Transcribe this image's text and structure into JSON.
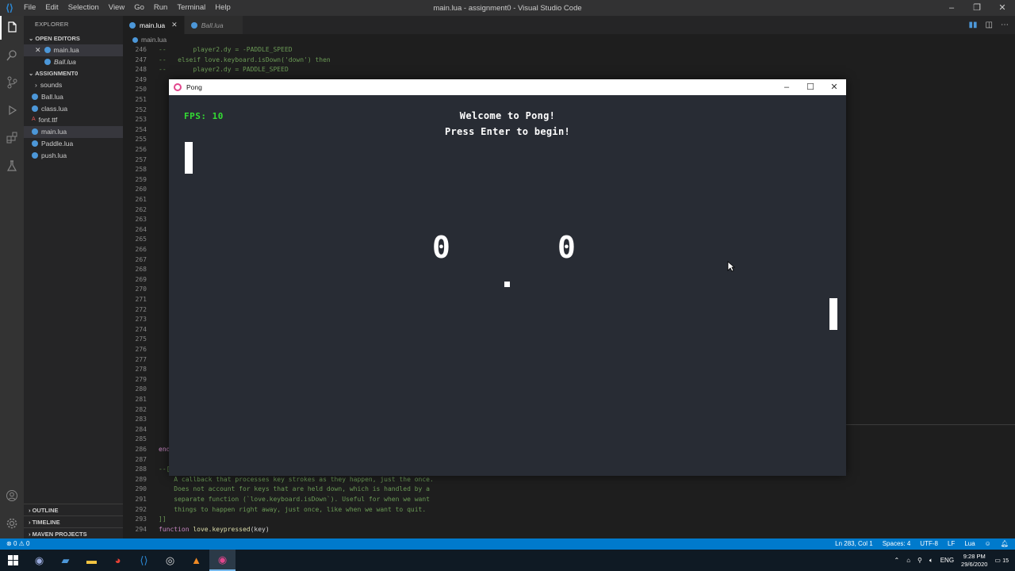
{
  "titlebar": {
    "menu": [
      "File",
      "Edit",
      "Selection",
      "View",
      "Go",
      "Run",
      "Terminal",
      "Help"
    ],
    "title": "main.lua - assignment0 - Visual Studio Code"
  },
  "sidebar": {
    "title": "EXPLORER",
    "open_editors_header": "OPEN EDITORS",
    "open_editors": [
      {
        "label": "main.lua"
      },
      {
        "label": "Ball.lua"
      }
    ],
    "project_header": "ASSIGNMENT0",
    "files": [
      {
        "label": "sounds",
        "kind": "folder"
      },
      {
        "label": "Ball.lua",
        "kind": "lua"
      },
      {
        "label": "class.lua",
        "kind": "lua"
      },
      {
        "label": "font.ttf",
        "kind": "font"
      },
      {
        "label": "main.lua",
        "kind": "lua"
      },
      {
        "label": "Paddle.lua",
        "kind": "lua"
      },
      {
        "label": "push.lua",
        "kind": "lua"
      }
    ],
    "outline": "OUTLINE",
    "timeline": "TIMELINE",
    "maven": "MAVEN PROJECTS"
  },
  "tabs": [
    {
      "label": "main.lua"
    },
    {
      "label": "Ball.lua"
    }
  ],
  "breadcrumb": "main.lua",
  "editor": {
    "line_numbers": [
      "246",
      "247",
      "248",
      "249",
      "250",
      "251",
      "252",
      "253",
      "254",
      "255",
      "256",
      "257",
      "258",
      "259",
      "260",
      "261",
      "262",
      "263",
      "264",
      "265",
      "266",
      "267",
      "268",
      "269",
      "270",
      "271",
      "272",
      "273",
      "274",
      "275",
      "276",
      "277",
      "278",
      "279",
      "280",
      "281",
      "282",
      "283",
      "284",
      "285",
      "286",
      "287",
      "288",
      "289",
      "290",
      "291",
      "292",
      "293",
      "294"
    ],
    "code_top": [
      "--       player2.dy = -PADDLE_SPEED",
      "--   elseif love.keyboard.isDown('down') then",
      "--       player2.dy = PADDLE_SPEED"
    ],
    "code_end": "end",
    "code_comment_open": "--[[",
    "comment_lines": [
      "    A callback that processes key strokes as they happen, just the once.",
      "    Does not account for keys that are held down, which is handled by a",
      "    separate function (`love.keyboard.isDown`). Useful for when we want",
      "    things to happen right away, just once, like when we want to quit."
    ],
    "comment_close": "]]",
    "fn_keyword": "function",
    "fn_name": "love.keypressed",
    "fn_args": "(key)"
  },
  "pong": {
    "window_title": "Pong",
    "fps_label": "FPS: 10",
    "welcome": "Welcome to Pong!",
    "press_enter": "Press Enter to begin!",
    "player1_score": "0",
    "player2_score": "0"
  },
  "statusbar": {
    "errors": "0",
    "warnings": "0",
    "position": "Ln 283, Col 1",
    "spaces": "Spaces: 4",
    "encoding": "UTF-8",
    "eol": "LF",
    "language": "Lua"
  },
  "taskbar": {
    "language": "ENG",
    "time": "9:28 PM",
    "date": "29/6/2020",
    "notifications": "15"
  }
}
